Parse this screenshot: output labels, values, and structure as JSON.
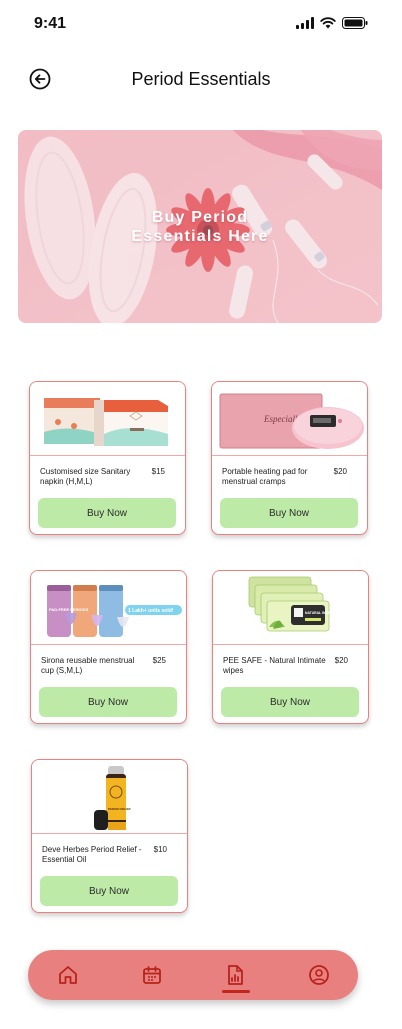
{
  "status_bar": {
    "time": "9:41"
  },
  "header": {
    "title": "Period Essentials"
  },
  "banner": {
    "line1": "Buy Period",
    "line2": "Essentials Here"
  },
  "products": [
    {
      "name": "Customised size Sanitary napkin (H,M,L)",
      "price": "$15",
      "button": "Buy Now"
    },
    {
      "name": "Portable heating pad for menstrual cramps",
      "price": "$20",
      "button": "Buy Now"
    },
    {
      "name": "Sirona reusable menstrual cup (S,M,L)",
      "price": "$25",
      "button": "Buy Now"
    },
    {
      "name": "PEE SAFE - Natural Intimate wipes",
      "price": "$20",
      "button": "Buy Now"
    },
    {
      "name": "Deve Herbes Period Relief - Essential Oil",
      "price": "$10",
      "button": "Buy Now"
    }
  ],
  "product_image_text": {
    "heating_pad_script": "Especially fo",
    "cup_tag": "1 Lakh+ units sold!",
    "cup_box": "PAD-FREE PERIODS",
    "wipes_label": "NATURAL INTIMATE",
    "oil_label": "PERIOD RELIEF"
  },
  "bottom_nav": {
    "items": [
      "home-icon",
      "calendar-icon",
      "report-icon",
      "profile-icon"
    ],
    "active": "report-icon"
  },
  "colors": {
    "accent": "#e98080",
    "card_border": "#e8827f",
    "buy_button": "#bdeba7",
    "active_indicator": "#c0271f"
  }
}
